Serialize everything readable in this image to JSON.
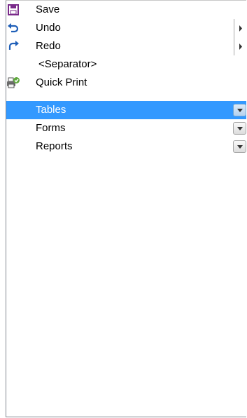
{
  "items": [
    {
      "label": "Save",
      "icon": "floppy-disk-icon",
      "control": "none",
      "selected": false
    },
    {
      "label": "Undo",
      "icon": "undo-arrow-icon",
      "control": "submenu-arrow",
      "selected": false
    },
    {
      "label": "Redo",
      "icon": "redo-arrow-icon",
      "control": "submenu-arrow",
      "selected": false
    },
    {
      "label": "<Separator>",
      "icon": "",
      "control": "none",
      "selected": false
    },
    {
      "label": "Quick Print",
      "icon": "printer-check-icon",
      "control": "none",
      "selected": false
    },
    {
      "label": "Tables",
      "icon": "",
      "control": "dropdown-button",
      "selected": true
    },
    {
      "label": "Forms",
      "icon": "",
      "control": "dropdown-button",
      "selected": false
    },
    {
      "label": "Reports",
      "icon": "",
      "control": "dropdown-button",
      "selected": false
    }
  ],
  "colors": {
    "selection_background": "#3399ff",
    "selection_text": "#ffffff",
    "save_icon": "#7a2a8a",
    "arrow_icon": "#1f5fb8"
  }
}
